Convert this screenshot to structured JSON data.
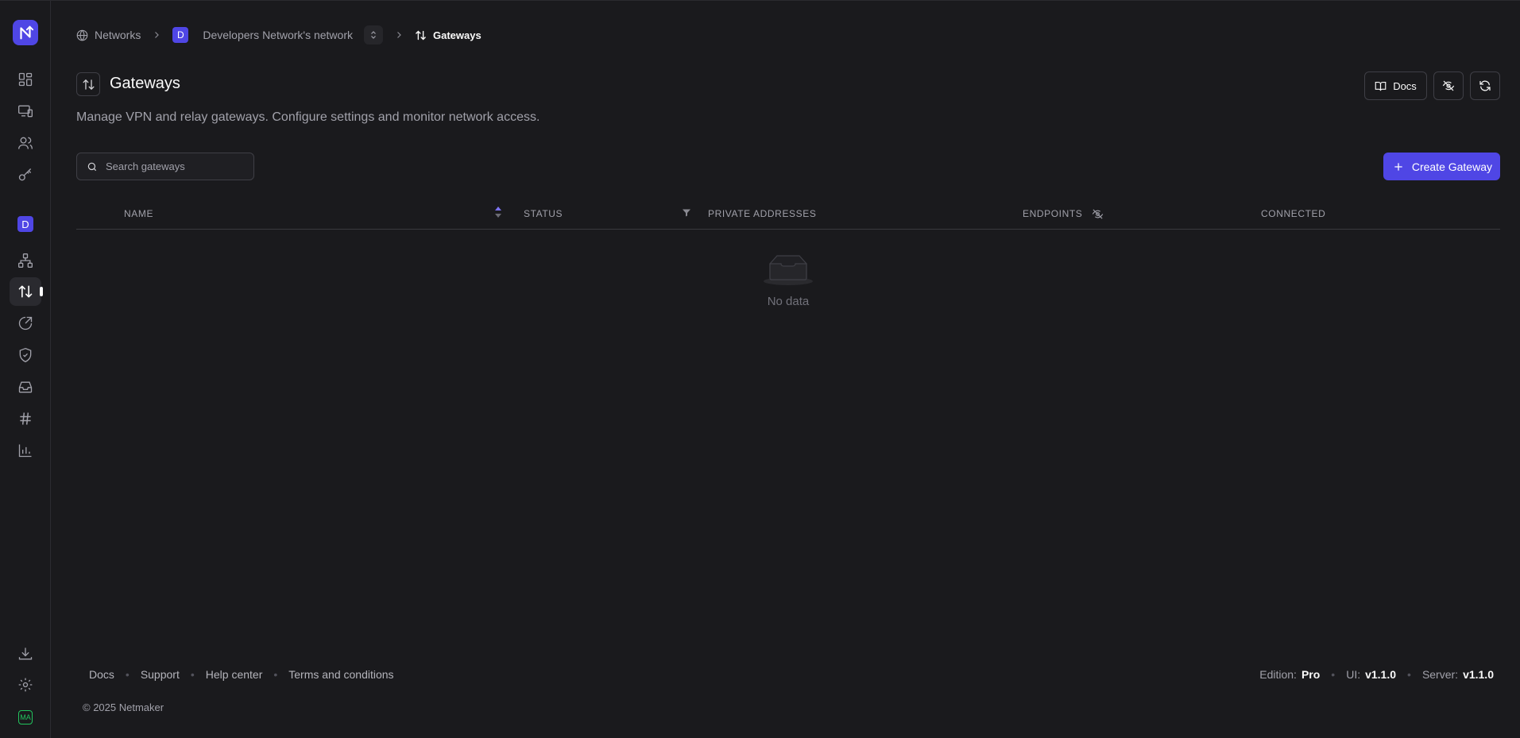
{
  "sidebar": {
    "logo_icon": "netmaker-logo-icon",
    "items": [
      {
        "name": "dashboard",
        "icon": "dashboard-grid-icon"
      },
      {
        "name": "devices",
        "icon": "devices-icon"
      },
      {
        "name": "users",
        "icon": "users-icon"
      },
      {
        "name": "keys",
        "icon": "key-icon"
      },
      {
        "name": "topology",
        "icon": "topology-icon"
      },
      {
        "name": "gateways",
        "icon": "arrows-up-down-icon",
        "active": true
      },
      {
        "name": "egress",
        "icon": "egress-icon"
      },
      {
        "name": "acls",
        "icon": "shield-check-icon"
      },
      {
        "name": "inbox",
        "icon": "inbox-icon"
      },
      {
        "name": "dns",
        "icon": "hash-icon"
      },
      {
        "name": "metrics",
        "icon": "bar-chart-icon"
      },
      {
        "name": "downloads",
        "icon": "download-icon"
      },
      {
        "name": "settings",
        "icon": "gear-icon"
      }
    ],
    "network_avatar": "D",
    "user_initials": "MA"
  },
  "breadcrumb": {
    "networks": "Networks",
    "network_avatar": "D",
    "network_name": "Developers Network's network",
    "current": "Gateways"
  },
  "header": {
    "title": "Gateways",
    "description": "Manage VPN and relay gateways. Configure settings and monitor network access.",
    "docs_label": "Docs"
  },
  "search": {
    "placeholder": "Search gateways"
  },
  "create_button": {
    "label": "Create Gateway"
  },
  "table": {
    "columns": [
      "NAME",
      "STATUS",
      "PRIVATE ADDRESSES",
      "ENDPOINTS",
      "CONNECTED"
    ],
    "rows": [],
    "empty_text": "No data"
  },
  "footer": {
    "links": [
      "Docs",
      "Support",
      "Help center",
      "Terms and conditions"
    ],
    "copyright": "© 2025 Netmaker",
    "edition_label": "Edition:",
    "edition_value": "Pro",
    "ui_label": "UI:",
    "ui_value": "v1.1.0",
    "server_label": "Server:",
    "server_value": "v1.1.0"
  },
  "colors": {
    "accent": "#4f46e5",
    "background": "#1a1a1d"
  }
}
